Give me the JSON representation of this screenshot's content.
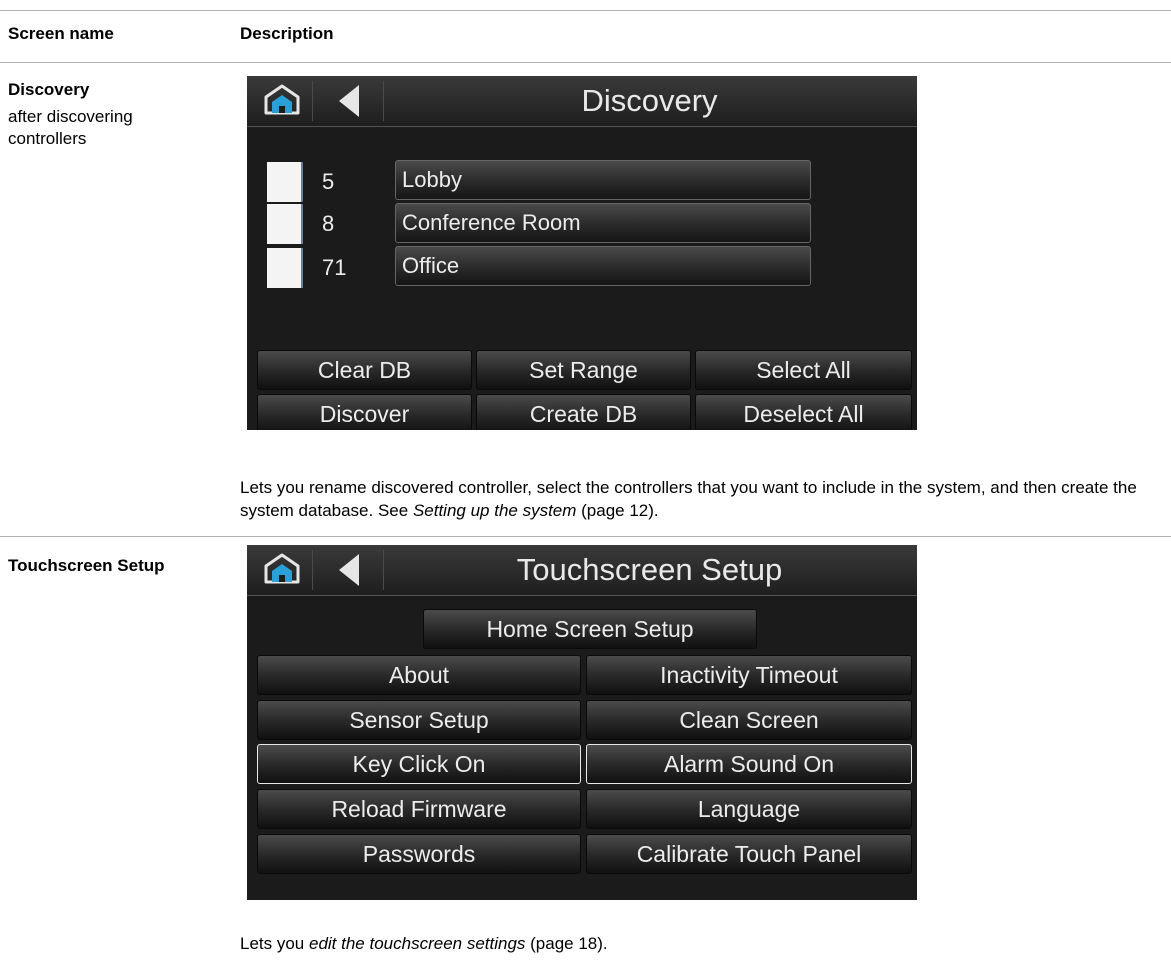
{
  "table": {
    "col_screen_name": "Screen name",
    "col_description": "Description"
  },
  "rows": [
    {
      "name": "Discovery",
      "subtitle": "after discovering controllers",
      "screen": {
        "title": "Discovery",
        "controllers": [
          {
            "address": "5",
            "name": "Lobby"
          },
          {
            "address": "8",
            "name": "Conference Room"
          },
          {
            "address": "71",
            "name": "Office"
          }
        ],
        "buttons": [
          "Clear DB",
          "Set Range",
          "Select All",
          "Discover",
          "Create DB",
          "Deselect All"
        ]
      },
      "description": {
        "text1": "Lets you rename discovered controller, select the controllers that you want to include in the system, and then create the system database. See ",
        "link": "Setting up the system",
        "text2": " (page 12)."
      }
    },
    {
      "name": "Touchscreen Setup",
      "screen": {
        "title": "Touchscreen Setup",
        "top_button": "Home Screen Setup",
        "buttons": [
          {
            "label": "About",
            "selected": false
          },
          {
            "label": "Inactivity Timeout",
            "selected": false
          },
          {
            "label": "Sensor Setup",
            "selected": false
          },
          {
            "label": "Clean Screen",
            "selected": false
          },
          {
            "label": "Key Click On",
            "selected": true
          },
          {
            "label": "Alarm Sound On",
            "selected": true
          },
          {
            "label": "Reload Firmware",
            "selected": false
          },
          {
            "label": "Language",
            "selected": false
          },
          {
            "label": "Passwords",
            "selected": false
          },
          {
            "label": "Calibrate Touch Panel",
            "selected": false
          }
        ]
      },
      "description": {
        "text1": "Lets you ",
        "link": "edit the touchscreen settings",
        "text2": " (page 18)."
      }
    }
  ],
  "colors": {
    "panel_bg": "#1b1b1b",
    "home_icon_accent": "#2aa0d8"
  }
}
